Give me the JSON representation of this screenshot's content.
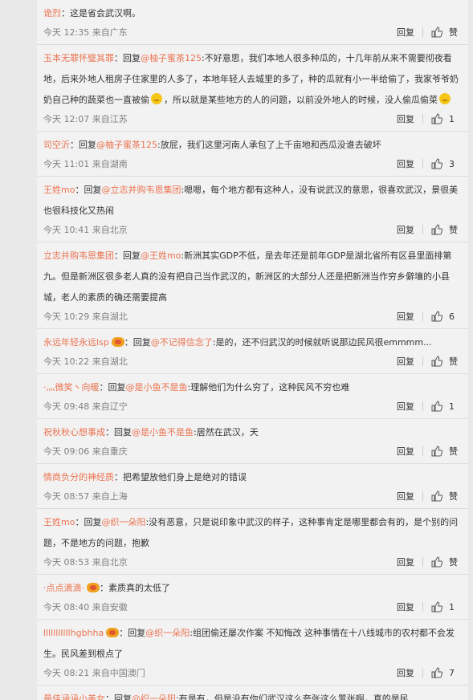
{
  "comments": [
    {
      "user": "诡烈",
      "color": "orange",
      "badge": false,
      "reply_to": "",
      "text": "：这是省会武汉啊。",
      "emoji_after": false,
      "time": "今天 12:35 来自广东",
      "reply_label": "回复",
      "like_count": "赞"
    },
    {
      "user": "玉本无罪怀璧其罪",
      "color": "orange",
      "badge": false,
      "reply_to": "@柚子蜜茶125",
      "text": ":不好意思，我们本地人很多种瓜的，十几年前从来不需要彻夜看地，后来外地人租房子住家里的人多了，本地年轻人去城里的多了，种的瓜就有小一半给偷了，我家爷爷奶奶自己种的蔬菜也一直被偷",
      "emoji_mid": true,
      "text2": "，所以就是某些地方的人的问题，以前没外地人的时候，没人偷瓜偷菜",
      "emoji_after": true,
      "time": "今天 12:07 来自江苏",
      "reply_label": "回复",
      "like_count": "1"
    },
    {
      "user": "司空沂",
      "color": "orange",
      "badge": false,
      "reply_to": "@柚子蜜茶125",
      "text": ":放屁，我们这里河南人承包了上千亩地和西瓜没谁去破坏",
      "emoji_after": false,
      "time": "今天 11:01 来自湖南",
      "reply_label": "回复",
      "like_count": "3"
    },
    {
      "user": "王姓mo",
      "color": "orange",
      "badge": false,
      "reply_to": "@立志并购韦恩集团",
      "text": ":嗯嗯，每个地方都有这种人，没有说武汉的意思，很喜欢武汉，景很美也很科技化又热闹",
      "emoji_after": false,
      "time": "今天 10:41 来自北京",
      "reply_label": "回复",
      "like_count": "赞"
    },
    {
      "user": "立志并购韦恩集团",
      "color": "orange",
      "badge": false,
      "reply_to": "@王姓mo",
      "text": ":新洲其实GDP不低，是去年还是前年GDP是湖北省所有区县里面排第九。但是新洲区很多老人真的没有把自己当作武汉的，新洲区的大部分人还是把新洲当作穷乡僻壤的小县城，老人的素质的确还需要提高",
      "emoji_after": false,
      "time": "今天 10:29 来自湖北",
      "reply_label": "回复",
      "like_count": "6"
    },
    {
      "user": "永远年轻永远lsp",
      "color": "orange",
      "badge": true,
      "reply_to": "@不记得信念了",
      "text": ":是的，还不归武汉的时候就听说那边民风很emmmm...",
      "emoji_after": false,
      "time": "今天 10:22 来自湖北",
      "reply_label": "回复",
      "like_count": "赞"
    },
    {
      "user": "·灬微笑丶向暖",
      "color": "orange",
      "badge": false,
      "reply_to": "@是小鱼不是鱼",
      "text": ":理解他们为什么穷了，这种民风不穷也难",
      "emoji_after": false,
      "time": "今天 09:48 来自辽宁",
      "reply_label": "回复",
      "like_count": "1"
    },
    {
      "user": "祝秋秋心想事成",
      "color": "orange",
      "badge": false,
      "reply_to": "@是小鱼不是鱼",
      "text": ":居然在武汉，天",
      "emoji_after": false,
      "time": "今天 09:06 来自重庆",
      "reply_label": "回复",
      "like_count": "赞"
    },
    {
      "user": "情商负分的神经质",
      "color": "orange",
      "badge": false,
      "reply_to": "",
      "text": "：把希望放他们身上是绝对的错误",
      "emoji_after": false,
      "time": "今天 08:57 来自上海",
      "reply_label": "回复",
      "like_count": "赞"
    },
    {
      "user": "王姓mo",
      "color": "orange",
      "badge": false,
      "reply_to": "@织一朵阳",
      "text": ":没有恶意，只是说印象中武汉的样子，这种事肯定是哪里都会有的，是个别的问题，不是地方的问题，抱歉",
      "emoji_after": false,
      "time": "今天 08:53 来自北京",
      "reply_label": "回复",
      "like_count": "赞"
    },
    {
      "user": "·点点滴滴·",
      "color": "orange",
      "badge": true,
      "reply_to": "",
      "text": "：素质真的太低了",
      "emoji_after": false,
      "time": "今天 08:40 来自安徽",
      "reply_label": "回复",
      "like_count": "1"
    },
    {
      "user": "lllllllllllhgbhha",
      "color": "orange",
      "badge": true,
      "reply_to": "@织一朵阳",
      "text": ":组团偷还屡次作案 不知悔改 这种事情在十八线城市的农村都不会发生。民风差到根点了",
      "emoji_after": false,
      "time": "今天 08:21 来自中国澳门",
      "reply_label": "回复",
      "like_count": "7"
    },
    {
      "user": "最佳涵涵小美女",
      "color": "orange",
      "badge": false,
      "reply_to": "@织一朵阳",
      "text": ":有是有，但是没有你们武汉这么夸张这么嚣张啊，真的是民",
      "emoji_after": false,
      "time": "",
      "reply_label": "",
      "like_count": ""
    }
  ],
  "reply_prefix": "回复"
}
